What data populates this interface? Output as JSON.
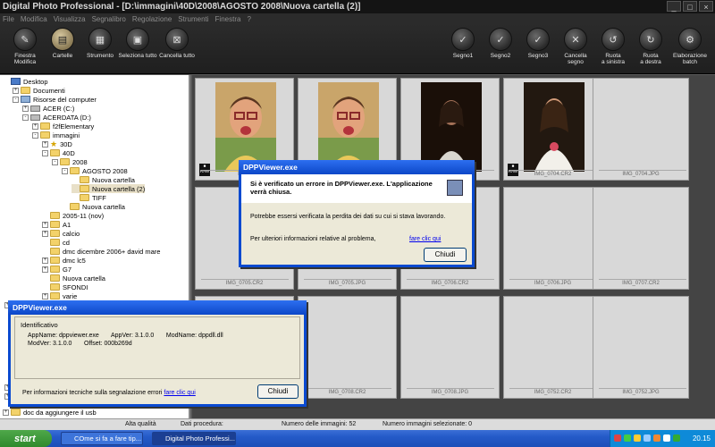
{
  "window": {
    "title": "Digital Photo Professional - [D:\\immagini\\40D\\2008\\AGOSTO 2008\\Nuova cartella (2)]",
    "controls": [
      "_",
      "□",
      "×"
    ]
  },
  "menu": [
    "File",
    "Modifica",
    "Visualizza",
    "Segnalibro",
    "Regolazione",
    "Strumenti",
    "Finestra",
    "?"
  ],
  "toolbar": {
    "left": [
      {
        "label": "Finestra\nModifica",
        "icon": "edit-window-icon",
        "glyph": "✎"
      },
      {
        "label": "Cartelle",
        "icon": "folders-icon",
        "glyph": "▤"
      },
      {
        "label": "Strumento",
        "icon": "tool-palette-icon",
        "glyph": "▦"
      },
      {
        "label": "Seleziona tutto",
        "icon": "select-all-icon",
        "glyph": "▣"
      },
      {
        "label": "Cancella tutto",
        "icon": "clear-all-icon",
        "glyph": "⊠"
      }
    ],
    "right": [
      {
        "label": "Segno1",
        "icon": "check-mark-1-icon",
        "glyph": "✓"
      },
      {
        "label": "Segno2",
        "icon": "check-mark-2-icon",
        "glyph": "✓"
      },
      {
        "label": "Segno3",
        "icon": "check-mark-3-icon",
        "glyph": "✓"
      },
      {
        "label": "Cancella\nsegno",
        "icon": "clear-mark-icon",
        "glyph": "✕"
      },
      {
        "label": "Ruota\na sinistra",
        "icon": "rotate-left-icon",
        "glyph": "↺"
      },
      {
        "label": "Ruota\na destra",
        "icon": "rotate-right-icon",
        "glyph": "↻"
      },
      {
        "label": "Elaborazione\nbatch",
        "icon": "batch-process-icon",
        "glyph": "⚙"
      }
    ]
  },
  "tree": [
    {
      "label": "Desktop",
      "indent": 0,
      "icon": "desktop",
      "toggle": ""
    },
    {
      "label": "Documenti",
      "indent": 1,
      "icon": "folder",
      "toggle": "+"
    },
    {
      "label": "Risorse del computer",
      "indent": 1,
      "icon": "pc",
      "toggle": "-"
    },
    {
      "label": "ACER (C:)",
      "indent": 2,
      "icon": "drive",
      "toggle": "+"
    },
    {
      "label": "ACERDATA (D:)",
      "indent": 2,
      "icon": "drive",
      "toggle": "-"
    },
    {
      "label": "f2fElementary",
      "indent": 3,
      "icon": "folder",
      "toggle": "+"
    },
    {
      "label": "immagini",
      "indent": 3,
      "icon": "folder",
      "toggle": "-"
    },
    {
      "label": "30D",
      "indent": 4,
      "icon": "star",
      "toggle": "+"
    },
    {
      "label": "40D",
      "indent": 4,
      "icon": "folder",
      "toggle": "-"
    },
    {
      "label": "2008",
      "indent": 5,
      "icon": "folder",
      "toggle": "-"
    },
    {
      "label": "AGOSTO 2008",
      "indent": 6,
      "icon": "folder",
      "toggle": "-"
    },
    {
      "label": "Nuova cartella",
      "indent": 7,
      "icon": "folder",
      "toggle": ""
    },
    {
      "label": "Nuova cartella (2)",
      "indent": 7,
      "icon": "folder",
      "toggle": "",
      "selected": true
    },
    {
      "label": "TIFF",
      "indent": 7,
      "icon": "folder",
      "toggle": ""
    },
    {
      "label": "Nuova cartella",
      "indent": 6,
      "icon": "folder",
      "toggle": ""
    },
    {
      "label": "2005-11 (nov)",
      "indent": 4,
      "icon": "folder",
      "toggle": ""
    },
    {
      "label": "A1",
      "indent": 4,
      "icon": "folder",
      "toggle": "+"
    },
    {
      "label": "calcio",
      "indent": 4,
      "icon": "folder",
      "toggle": "+"
    },
    {
      "label": "cd",
      "indent": 4,
      "icon": "folder",
      "toggle": ""
    },
    {
      "label": "dmc dicembre 2006+ david mare",
      "indent": 4,
      "icon": "folder",
      "toggle": ""
    },
    {
      "label": "dmc lc5",
      "indent": 4,
      "icon": "folder",
      "toggle": "+"
    },
    {
      "label": "G7",
      "indent": 4,
      "icon": "folder",
      "toggle": "+"
    },
    {
      "label": "Nuova cartella",
      "indent": 4,
      "icon": "folder",
      "toggle": ""
    },
    {
      "label": "SFONDI",
      "indent": 4,
      "icon": "folder",
      "toggle": ""
    },
    {
      "label": "varie",
      "indent": 4,
      "icon": "folder",
      "toggle": "+"
    }
  ],
  "tree_bottom": {
    "label": "doc da aggiungere il usb"
  },
  "thumbnails": [
    {
      "name": "IMG_",
      "photo": "boy",
      "raw": true
    },
    {
      "name": "",
      "photo": "boy",
      "raw": false
    },
    {
      "name": "",
      "photo": "girl-dark",
      "raw": false
    },
    {
      "name": "IMG_0704.CR2",
      "photo": "girl",
      "raw": true
    },
    {
      "name": "IMG_0704.JPG",
      "photo": "",
      "raw": false
    },
    {
      "name": "IMG_0705.CR2",
      "photo": "",
      "raw": false
    },
    {
      "name": "IMG_0705.JPG",
      "photo": "",
      "raw": false
    },
    {
      "name": "IMG_0706.CR2",
      "photo": "",
      "raw": false
    },
    {
      "name": "IMG_0706.JPG",
      "photo": "",
      "raw": false
    },
    {
      "name": "IMG_0707.CR2",
      "photo": "",
      "raw": false
    },
    {
      "name": "",
      "photo": "",
      "raw": false
    },
    {
      "name": "IMG_0708.CR2",
      "photo": "",
      "raw": false
    },
    {
      "name": "IMG_0708.JPG",
      "photo": "",
      "raw": false
    },
    {
      "name": "IMG_0752.CR2",
      "photo": "",
      "raw": false
    },
    {
      "name": "IMG_0752.JPG",
      "photo": "",
      "raw": false
    }
  ],
  "status": {
    "quality": "Alta qualità",
    "procedure": "Dati procedura:",
    "count": "Numero delle immagini: 52",
    "selected": "Numero immagini selezionate: 0"
  },
  "taskbar": {
    "start": "start",
    "tasks": [
      "COme si fa a fare tip...",
      "Digital Photo Professi..."
    ],
    "clock": "20.15"
  },
  "error_dialog": {
    "title": "DPPViewer.exe",
    "heading": "Si è verificato un errore in DPPViewer.exe. L'applicazione verrà chiusa.",
    "body": "Potrebbe essersi verificata la perdita dei dati su cui si stava lavorando.",
    "more_info": "Per ulteriori informazioni relative al problema,",
    "link": "fare clic qui",
    "button": "Chiudi"
  },
  "detail_dialog": {
    "title": "DPPViewer.exe",
    "group_label": "Identificativo",
    "line1": "AppName: dppviewer.exe       AppVer: 3.1.0.0       ModName: dppdll.dll",
    "line2": "ModVer: 3.1.0.0       Offset: 000b269d",
    "tech_info": "Per informazioni tecniche sulla segnalazione errori",
    "link": "fare clic qui",
    "button": "Chiudi"
  }
}
